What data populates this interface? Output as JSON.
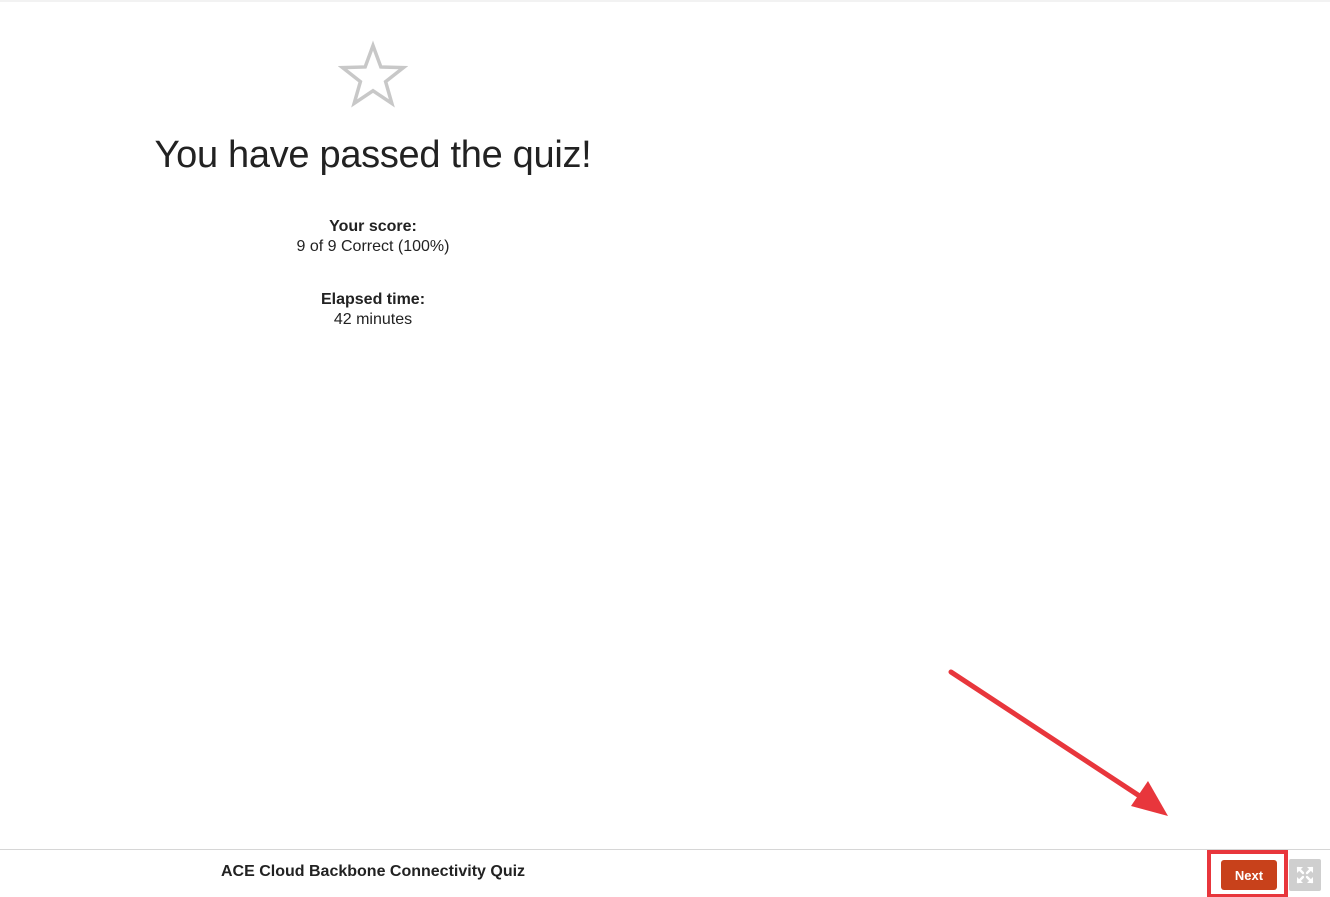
{
  "result": {
    "icon": "star-outline-icon",
    "title": "You have passed the quiz!",
    "score_label": "Your score:",
    "score_value": "9 of 9 Correct (100%)",
    "time_label": "Elapsed time:",
    "time_value": "42 minutes"
  },
  "footer": {
    "quiz_title": "ACE Cloud Backbone Connectivity Quiz",
    "next_label": "Next",
    "fullscreen_icon": "expand-icon"
  },
  "colors": {
    "next_button": "#c8411b",
    "annotation": "#e8363c",
    "star": "#c8c8c8"
  }
}
